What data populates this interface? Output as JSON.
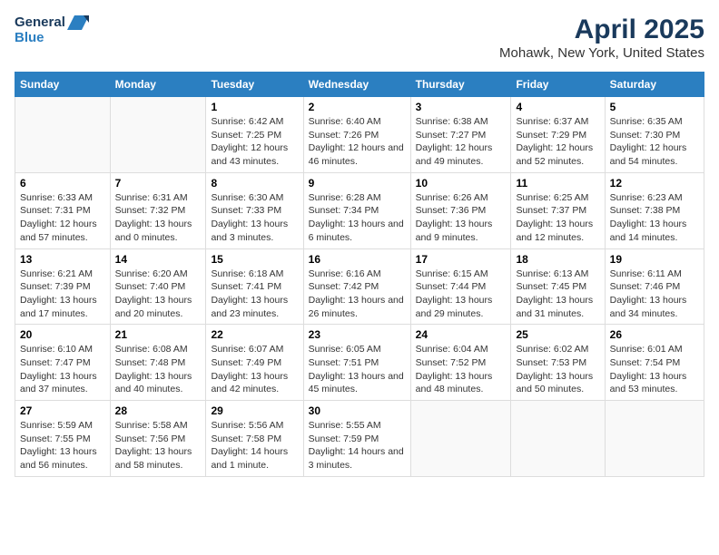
{
  "header": {
    "logo_line1": "General",
    "logo_line2": "Blue",
    "title": "April 2025",
    "subtitle": "Mohawk, New York, United States"
  },
  "columns": [
    "Sunday",
    "Monday",
    "Tuesday",
    "Wednesday",
    "Thursday",
    "Friday",
    "Saturday"
  ],
  "weeks": [
    {
      "days": [
        {
          "num": "",
          "info": ""
        },
        {
          "num": "",
          "info": ""
        },
        {
          "num": "1",
          "info": "Sunrise: 6:42 AM\nSunset: 7:25 PM\nDaylight: 12 hours and 43 minutes."
        },
        {
          "num": "2",
          "info": "Sunrise: 6:40 AM\nSunset: 7:26 PM\nDaylight: 12 hours and 46 minutes."
        },
        {
          "num": "3",
          "info": "Sunrise: 6:38 AM\nSunset: 7:27 PM\nDaylight: 12 hours and 49 minutes."
        },
        {
          "num": "4",
          "info": "Sunrise: 6:37 AM\nSunset: 7:29 PM\nDaylight: 12 hours and 52 minutes."
        },
        {
          "num": "5",
          "info": "Sunrise: 6:35 AM\nSunset: 7:30 PM\nDaylight: 12 hours and 54 minutes."
        }
      ]
    },
    {
      "days": [
        {
          "num": "6",
          "info": "Sunrise: 6:33 AM\nSunset: 7:31 PM\nDaylight: 12 hours and 57 minutes."
        },
        {
          "num": "7",
          "info": "Sunrise: 6:31 AM\nSunset: 7:32 PM\nDaylight: 13 hours and 0 minutes."
        },
        {
          "num": "8",
          "info": "Sunrise: 6:30 AM\nSunset: 7:33 PM\nDaylight: 13 hours and 3 minutes."
        },
        {
          "num": "9",
          "info": "Sunrise: 6:28 AM\nSunset: 7:34 PM\nDaylight: 13 hours and 6 minutes."
        },
        {
          "num": "10",
          "info": "Sunrise: 6:26 AM\nSunset: 7:36 PM\nDaylight: 13 hours and 9 minutes."
        },
        {
          "num": "11",
          "info": "Sunrise: 6:25 AM\nSunset: 7:37 PM\nDaylight: 13 hours and 12 minutes."
        },
        {
          "num": "12",
          "info": "Sunrise: 6:23 AM\nSunset: 7:38 PM\nDaylight: 13 hours and 14 minutes."
        }
      ]
    },
    {
      "days": [
        {
          "num": "13",
          "info": "Sunrise: 6:21 AM\nSunset: 7:39 PM\nDaylight: 13 hours and 17 minutes."
        },
        {
          "num": "14",
          "info": "Sunrise: 6:20 AM\nSunset: 7:40 PM\nDaylight: 13 hours and 20 minutes."
        },
        {
          "num": "15",
          "info": "Sunrise: 6:18 AM\nSunset: 7:41 PM\nDaylight: 13 hours and 23 minutes."
        },
        {
          "num": "16",
          "info": "Sunrise: 6:16 AM\nSunset: 7:42 PM\nDaylight: 13 hours and 26 minutes."
        },
        {
          "num": "17",
          "info": "Sunrise: 6:15 AM\nSunset: 7:44 PM\nDaylight: 13 hours and 29 minutes."
        },
        {
          "num": "18",
          "info": "Sunrise: 6:13 AM\nSunset: 7:45 PM\nDaylight: 13 hours and 31 minutes."
        },
        {
          "num": "19",
          "info": "Sunrise: 6:11 AM\nSunset: 7:46 PM\nDaylight: 13 hours and 34 minutes."
        }
      ]
    },
    {
      "days": [
        {
          "num": "20",
          "info": "Sunrise: 6:10 AM\nSunset: 7:47 PM\nDaylight: 13 hours and 37 minutes."
        },
        {
          "num": "21",
          "info": "Sunrise: 6:08 AM\nSunset: 7:48 PM\nDaylight: 13 hours and 40 minutes."
        },
        {
          "num": "22",
          "info": "Sunrise: 6:07 AM\nSunset: 7:49 PM\nDaylight: 13 hours and 42 minutes."
        },
        {
          "num": "23",
          "info": "Sunrise: 6:05 AM\nSunset: 7:51 PM\nDaylight: 13 hours and 45 minutes."
        },
        {
          "num": "24",
          "info": "Sunrise: 6:04 AM\nSunset: 7:52 PM\nDaylight: 13 hours and 48 minutes."
        },
        {
          "num": "25",
          "info": "Sunrise: 6:02 AM\nSunset: 7:53 PM\nDaylight: 13 hours and 50 minutes."
        },
        {
          "num": "26",
          "info": "Sunrise: 6:01 AM\nSunset: 7:54 PM\nDaylight: 13 hours and 53 minutes."
        }
      ]
    },
    {
      "days": [
        {
          "num": "27",
          "info": "Sunrise: 5:59 AM\nSunset: 7:55 PM\nDaylight: 13 hours and 56 minutes."
        },
        {
          "num": "28",
          "info": "Sunrise: 5:58 AM\nSunset: 7:56 PM\nDaylight: 13 hours and 58 minutes."
        },
        {
          "num": "29",
          "info": "Sunrise: 5:56 AM\nSunset: 7:58 PM\nDaylight: 14 hours and 1 minute."
        },
        {
          "num": "30",
          "info": "Sunrise: 5:55 AM\nSunset: 7:59 PM\nDaylight: 14 hours and 3 minutes."
        },
        {
          "num": "",
          "info": ""
        },
        {
          "num": "",
          "info": ""
        },
        {
          "num": "",
          "info": ""
        }
      ]
    }
  ]
}
